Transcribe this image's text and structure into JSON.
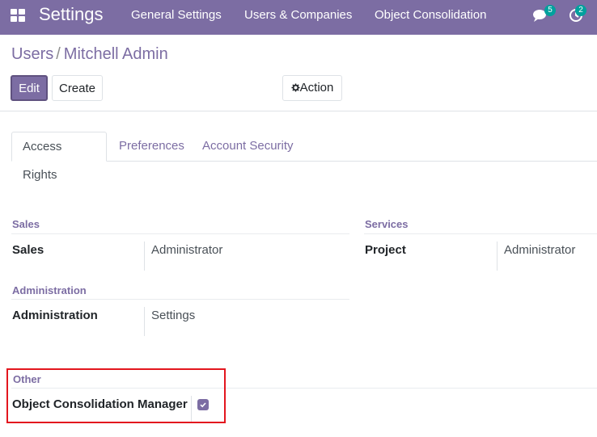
{
  "topbar": {
    "app_title": "Settings",
    "menu": [
      "General Settings",
      "Users & Companies",
      "Object Consolidation"
    ],
    "messages_badge": "5",
    "activities_badge": "2"
  },
  "breadcrumb": {
    "parent": "Users",
    "separator": "/",
    "current": "Mitchell Admin"
  },
  "controls": {
    "edit_label": "Edit",
    "create_label": "Create",
    "action_label": "Action"
  },
  "tabs": [
    {
      "label": "Access Rights",
      "active": true
    },
    {
      "label": "Preferences",
      "active": false
    },
    {
      "label": "Account Security",
      "active": false
    }
  ],
  "groups": {
    "sales": {
      "title": "Sales",
      "field_label": "Sales",
      "value": "Administrator"
    },
    "services": {
      "title": "Services",
      "field_label": "Project",
      "value": "Administrator"
    },
    "administration": {
      "title": "Administration",
      "field_label": "Administration",
      "value": "Settings"
    },
    "other": {
      "title": "Other",
      "field_label": "Object Consolidation Manager",
      "checked": true
    }
  },
  "colors": {
    "brand": "#7c6da3",
    "badge": "#00a09d",
    "highlight": "#e3161e"
  }
}
